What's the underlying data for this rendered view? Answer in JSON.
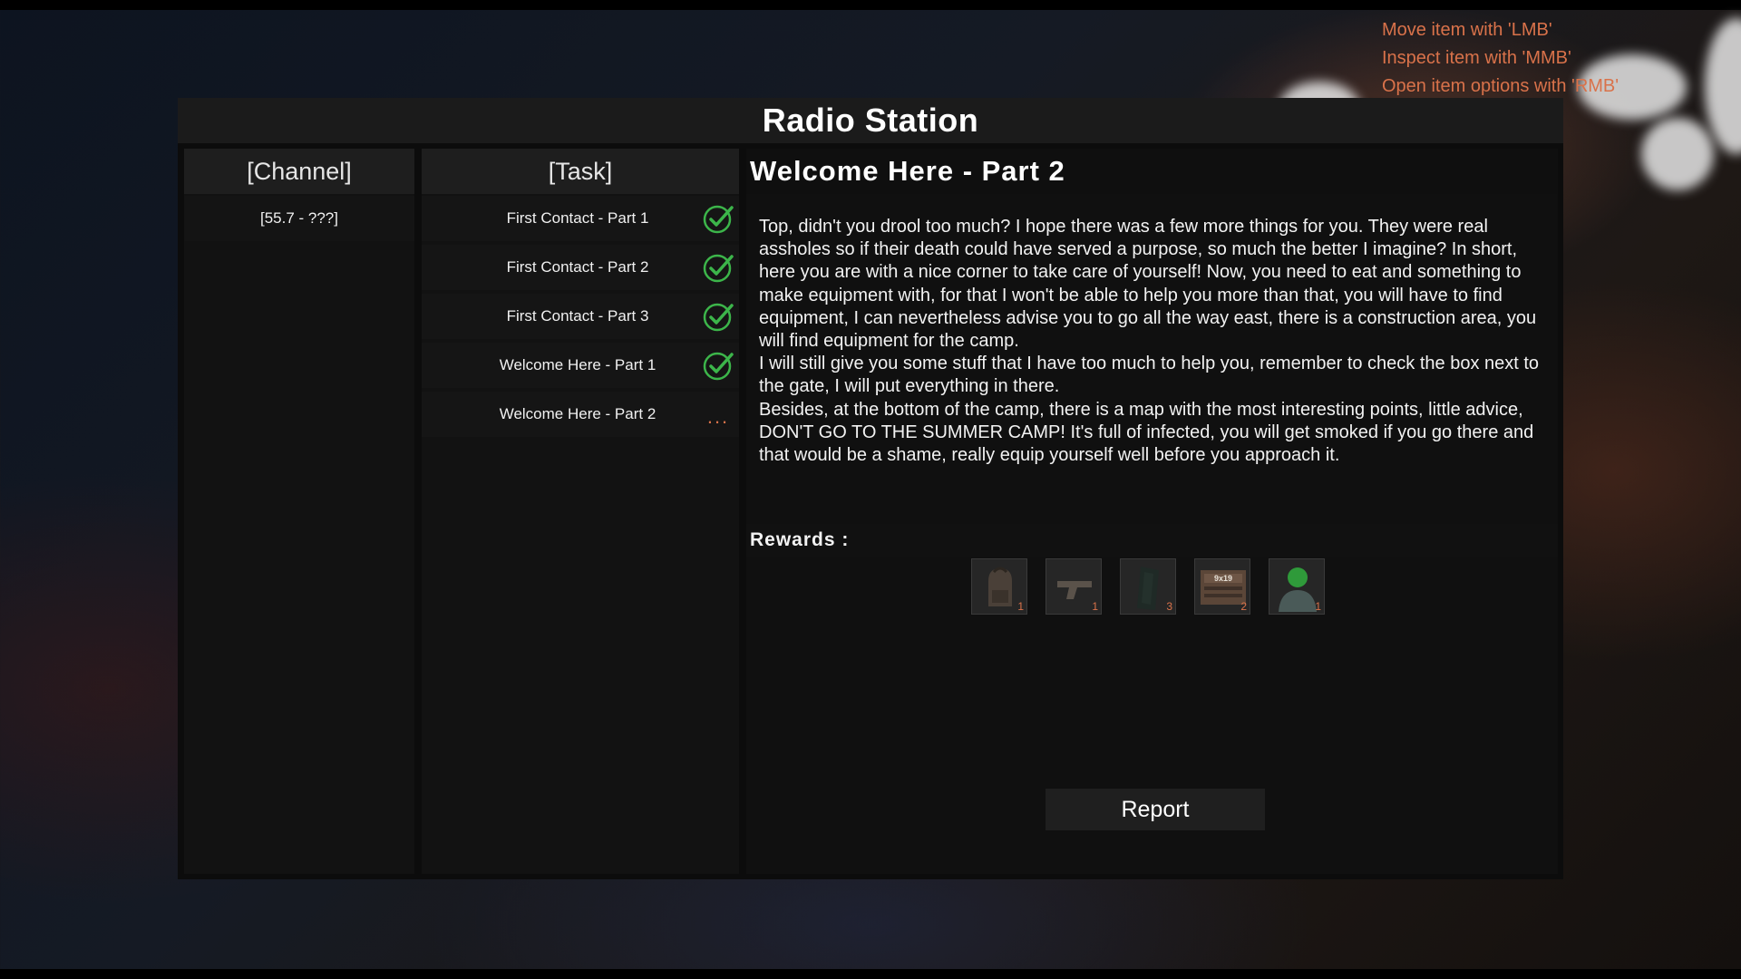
{
  "hints": [
    "Move item with 'LMB'",
    "Inspect item with 'MMB'",
    "Open item options with 'RMB'"
  ],
  "window": {
    "title": "Radio Station"
  },
  "channel": {
    "header": "[Channel]",
    "items": [
      {
        "label": "[55.7 - ???]"
      }
    ]
  },
  "task": {
    "header": "[Task]",
    "items": [
      {
        "label": "First Contact - Part 1",
        "status": "complete"
      },
      {
        "label": "First Contact - Part 2",
        "status": "complete"
      },
      {
        "label": "First Contact - Part 3",
        "status": "complete"
      },
      {
        "label": "Welcome Here - Part 1",
        "status": "complete"
      },
      {
        "label": "Welcome Here - Part 2",
        "status": "in-progress"
      }
    ],
    "in_progress_marker": "..."
  },
  "detail": {
    "title": "Welcome Here - Part 2",
    "paragraphs": [
      "Top, didn't you drool too much? I hope there was a few more things for you. They were real assholes so if their death could have served a purpose, so much the better I imagine? In short, here you are with a nice corner to take care of yourself! Now, you need to eat and something to make equipment with, for that I won't be able to help you more than that, you will have to find equipment, I can nevertheless advise you to go all the way east, there is a construction area, you will find equipment for the camp.",
      "I will still give you some stuff that I have too much to help you, remember to check the box next to the gate, I will put everything in there.",
      "Besides, at the bottom of the camp, there is a map with the most interesting points, little advice, DON'T GO TO THE SUMMER CAMP! It's full of infected, you will get smoked if you go there and that would be a shame, really equip yourself well before you approach it."
    ],
    "rewards_label": "Rewards :",
    "rewards": [
      {
        "icon": "backpack-icon",
        "qty": "1"
      },
      {
        "icon": "pistol-icon",
        "qty": "1"
      },
      {
        "icon": "cloth-icon",
        "qty": "3"
      },
      {
        "icon": "ammo-box-icon",
        "qty": "2",
        "box_text": "9x19"
      },
      {
        "icon": "green-item-icon",
        "qty": "1"
      }
    ],
    "report_label": "Report"
  },
  "colors": {
    "accent": "#d9724a",
    "check": "#3cb54a",
    "panel": "#121212",
    "header": "#1e1e1e"
  }
}
